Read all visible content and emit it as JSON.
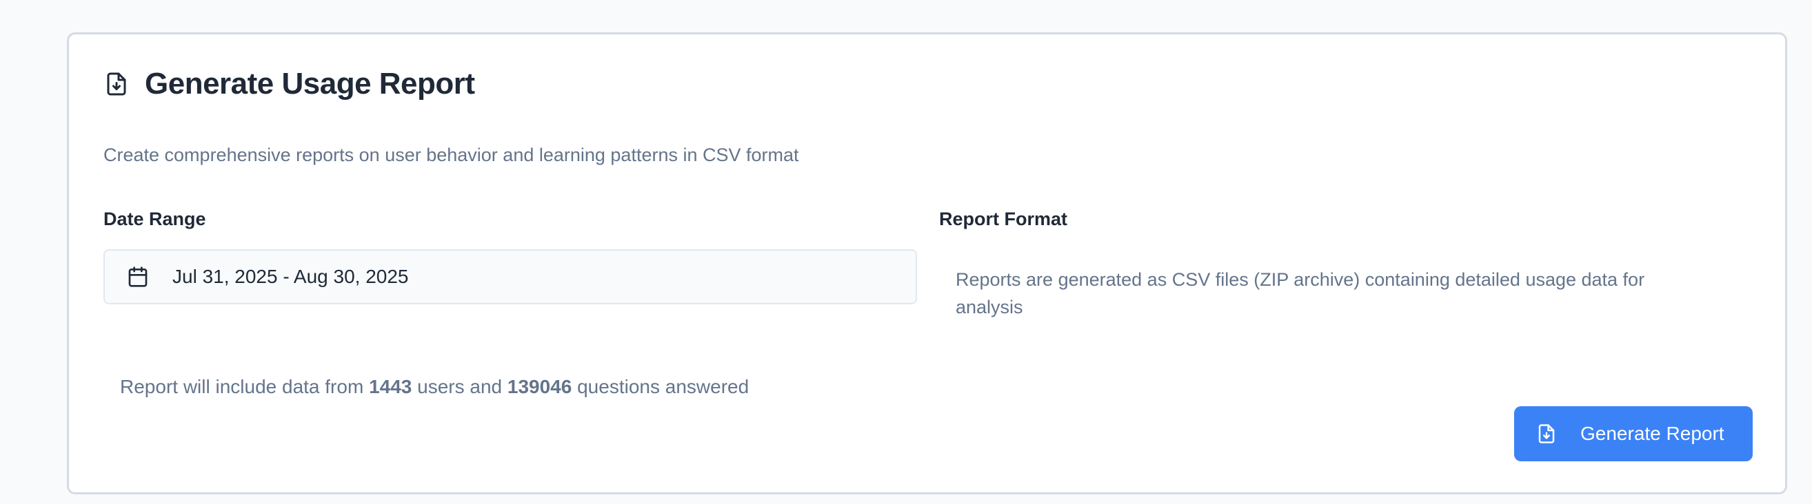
{
  "report": {
    "title": "Generate Usage Report",
    "subtitle": "Create comprehensive reports on user behavior and learning patterns in CSV format",
    "header_icon": "file-download-icon"
  },
  "date_range": {
    "label": "Date Range",
    "value": "Jul 31, 2025 - Aug 30, 2025",
    "icon": "calendar-icon"
  },
  "report_format": {
    "label": "Report Format",
    "description": "Reports are generated as CSV files (ZIP archive) containing detailed usage data for analysis"
  },
  "summary": {
    "prefix": "Report will include data from",
    "users_count": "1443",
    "middle": "users and",
    "questions_count": "139046",
    "suffix": "questions answered"
  },
  "actions": {
    "generate_label": "Generate Report",
    "generate_icon": "file-download-icon"
  },
  "colors": {
    "page_background": "#f8fafc",
    "card_border": "#d5dbe3",
    "primary_button": "#3b82f6",
    "heading_text": "#1f2937",
    "muted_text": "#64748b"
  }
}
